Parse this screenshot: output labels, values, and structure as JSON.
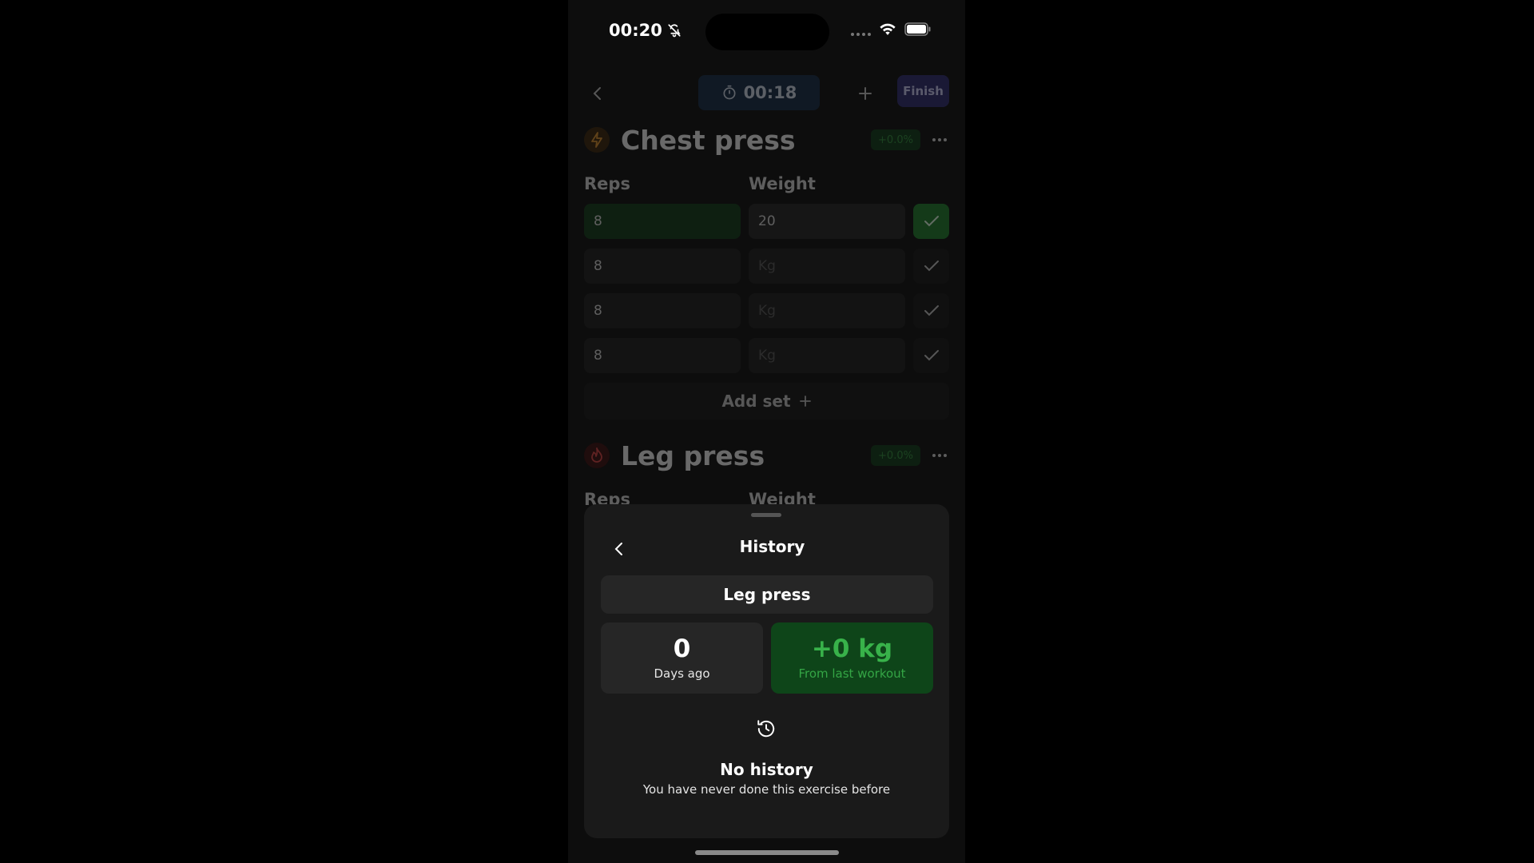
{
  "status": {
    "time": "00:20",
    "bell_icon": "bell-slash-icon",
    "wifi_icon": "wifi-icon",
    "battery_icon": "battery-icon"
  },
  "topbar": {
    "back_icon": "chevron-left-icon",
    "timer": "00:18",
    "timer_icon": "stopwatch-icon",
    "add_icon": "plus-icon",
    "finish_label": "Finish"
  },
  "exercises": [
    {
      "name": "Chest press",
      "icon": "lightning-icon",
      "change": "+0.0%",
      "reps_label": "Reps",
      "weight_label": "Weight",
      "sets": [
        {
          "reps": "8",
          "weight": "20",
          "weight_placeholder": "",
          "done": true
        },
        {
          "reps": "8",
          "weight": "",
          "weight_placeholder": "Kg",
          "done": false
        },
        {
          "reps": "8",
          "weight": "",
          "weight_placeholder": "Kg",
          "done": false
        },
        {
          "reps": "8",
          "weight": "",
          "weight_placeholder": "Kg",
          "done": false
        }
      ],
      "add_set_label": "Add set"
    },
    {
      "name": "Leg press",
      "icon": "flame-icon",
      "change": "+0.0%",
      "reps_label": "Reps",
      "weight_label": "Weight"
    }
  ],
  "sheet": {
    "title": "History",
    "exercise_name": "Leg press",
    "days_value": "0",
    "days_label": "Days ago",
    "change_value": "+0 kg",
    "change_label": "From last workout",
    "empty_icon": "history-icon",
    "empty_title": "No history",
    "empty_subtitle": "You have never done this exercise before"
  },
  "colors": {
    "accent_green": "#38b24a",
    "finish_purple": "#2e2b6e",
    "timer_blue": "#162a44"
  }
}
